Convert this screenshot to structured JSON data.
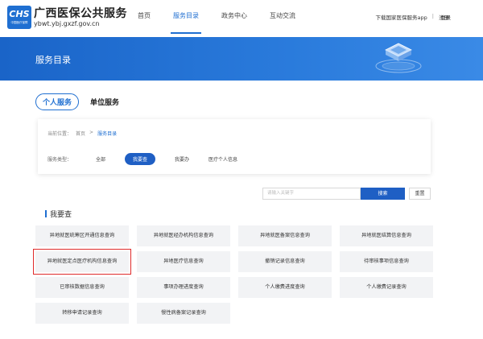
{
  "header": {
    "logo_text": "CHS",
    "logo_subtext": "中国医疗保障",
    "site_name": "广西医保公共服务",
    "site_url": "ybwt.ybj.gxzf.gov.cn",
    "nav": [
      {
        "label": "首页",
        "active": false
      },
      {
        "label": "服务目录",
        "active": true
      },
      {
        "label": "政务中心",
        "active": false
      },
      {
        "label": "互动交流",
        "active": false
      }
    ],
    "download_app": "下载国家医保服务app",
    "separator": "|",
    "register": "注册",
    "login": "登录"
  },
  "banner": {
    "title": "服务目录"
  },
  "tabs": [
    {
      "label": "个人服务",
      "active": true
    },
    {
      "label": "单位服务",
      "active": false
    }
  ],
  "filter": {
    "breadcrumb_label": "当前位置：",
    "breadcrumb": [
      "首页",
      "服务目录"
    ],
    "breadcrumb_sep": ">",
    "type_label": "服务类型：",
    "options": [
      {
        "label": "全部",
        "active": false
      },
      {
        "label": "我要查",
        "active": true
      },
      {
        "label": "我要办",
        "active": false
      },
      {
        "label": "医疗个人信息",
        "active": false
      }
    ]
  },
  "search": {
    "placeholder": "请输入关键字",
    "button": "搜索",
    "reset": "重置"
  },
  "section": {
    "title": "我要查",
    "items": [
      {
        "label": "异地就医统筹区开通信息查询",
        "highlighted": false
      },
      {
        "label": "异地就医经办机构信息查询",
        "highlighted": false
      },
      {
        "label": "异地就医备案信息查询",
        "highlighted": false
      },
      {
        "label": "异地就医结算信息查询",
        "highlighted": false
      },
      {
        "label": "异地就医定点医疗机构信息查询",
        "highlighted": true
      },
      {
        "label": "异地医疗信息查询",
        "highlighted": false
      },
      {
        "label": "撤销记录信息查询",
        "highlighted": false
      },
      {
        "label": "待审核事项信息查询",
        "highlighted": false
      },
      {
        "label": "已审核数据信息查询",
        "highlighted": false
      },
      {
        "label": "事项办理进度查询",
        "highlighted": false
      },
      {
        "label": "个人缴费进度查询",
        "highlighted": false
      },
      {
        "label": "个人缴费记录查询",
        "highlighted": false
      },
      {
        "label": "转移申请记录查询",
        "highlighted": false
      },
      {
        "label": "慢性病备案记录查询",
        "highlighted": false
      }
    ]
  },
  "colors": {
    "primary": "#1f6fd1",
    "banner": "#2a7bdc",
    "highlight": "#e02b2b"
  }
}
